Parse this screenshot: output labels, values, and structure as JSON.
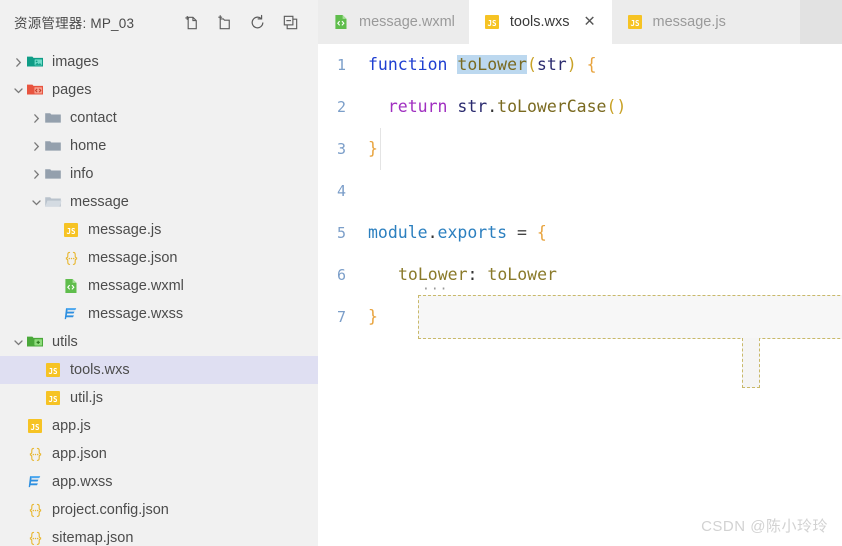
{
  "sidebar": {
    "title": "资源管理器: MP_03",
    "actions": [
      {
        "name": "new-file-icon",
        "label": "新建文件"
      },
      {
        "name": "new-folder-icon",
        "label": "新建文件夹"
      },
      {
        "name": "refresh-icon",
        "label": "刷新"
      },
      {
        "name": "collapse-all-icon",
        "label": "折叠全部"
      }
    ],
    "tree": [
      {
        "label": "images",
        "type": "folder",
        "icon": "folder-images-icon",
        "state": "collapsed",
        "depth": 0,
        "selected": false
      },
      {
        "label": "pages",
        "type": "folder",
        "icon": "folder-pages-icon",
        "state": "expanded",
        "depth": 0,
        "selected": false
      },
      {
        "label": "contact",
        "type": "folder",
        "icon": "folder-plain-icon",
        "state": "collapsed",
        "depth": 1,
        "selected": false
      },
      {
        "label": "home",
        "type": "folder",
        "icon": "folder-plain-icon",
        "state": "collapsed",
        "depth": 1,
        "selected": false
      },
      {
        "label": "info",
        "type": "folder",
        "icon": "folder-plain-icon",
        "state": "collapsed",
        "depth": 1,
        "selected": false
      },
      {
        "label": "message",
        "type": "folder",
        "icon": "folder-open-icon",
        "state": "expanded",
        "depth": 1,
        "selected": false
      },
      {
        "label": "message.js",
        "type": "file",
        "icon": "js-file-icon",
        "state": "none",
        "depth": 2,
        "selected": false
      },
      {
        "label": "message.json",
        "type": "file",
        "icon": "json-file-icon",
        "state": "none",
        "depth": 2,
        "selected": false
      },
      {
        "label": "message.wxml",
        "type": "file",
        "icon": "wxml-file-icon",
        "state": "none",
        "depth": 2,
        "selected": false
      },
      {
        "label": "message.wxss",
        "type": "file",
        "icon": "wxss-file-icon",
        "state": "none",
        "depth": 2,
        "selected": false
      },
      {
        "label": "utils",
        "type": "folder",
        "icon": "folder-utils-icon",
        "state": "expanded",
        "depth": 0,
        "selected": false
      },
      {
        "label": "tools.wxs",
        "type": "file",
        "icon": "js-file-icon",
        "state": "none",
        "depth": 1,
        "selected": true
      },
      {
        "label": "util.js",
        "type": "file",
        "icon": "js-file-icon",
        "state": "none",
        "depth": 1,
        "selected": false
      },
      {
        "label": "app.js",
        "type": "file",
        "icon": "js-file-icon",
        "state": "none",
        "depth": 0,
        "selected": false
      },
      {
        "label": "app.json",
        "type": "file",
        "icon": "json-file-icon",
        "state": "none",
        "depth": 0,
        "selected": false
      },
      {
        "label": "app.wxss",
        "type": "file",
        "icon": "wxss-file-icon",
        "state": "none",
        "depth": 0,
        "selected": false
      },
      {
        "label": "project.config.json",
        "type": "file",
        "icon": "json-file-icon",
        "state": "none",
        "depth": 0,
        "selected": false
      },
      {
        "label": "sitemap.json",
        "type": "file",
        "icon": "json-file-icon",
        "state": "none",
        "depth": 0,
        "selected": false
      }
    ]
  },
  "tabs": [
    {
      "label": "message.wxml",
      "icon": "wxml-file-icon",
      "active": false,
      "closable": false
    },
    {
      "label": "tools.wxs",
      "icon": "js-file-icon",
      "active": true,
      "closable": true,
      "close_label": "✕"
    },
    {
      "label": "message.js",
      "icon": "js-file-icon",
      "active": false,
      "closable": false
    }
  ],
  "editor": {
    "language": "wxs",
    "lines": [
      {
        "num": "1",
        "text": "function toLower(str) {"
      },
      {
        "num": "2",
        "text": "  return str.toLowerCase()"
      },
      {
        "num": "3",
        "text": "}"
      },
      {
        "num": "4",
        "text": ""
      },
      {
        "num": "5",
        "text": "module.exports = {"
      },
      {
        "num": "6",
        "text": "  toLower: toLower"
      },
      {
        "num": "7",
        "text": "}"
      }
    ],
    "tokens": {
      "l1_function": "function",
      "l1_name": "toLower",
      "l1_open_paren": "(",
      "l1_param": "str",
      "l1_close_paren": ")",
      "l1_space": " ",
      "l1_brace": "{",
      "l2_indent": "  ",
      "l2_return": "return",
      "l2_sp": " ",
      "l2_obj": "str",
      "l2_dot": ".",
      "l2_method": "toLowerCase",
      "l2_parens": "()",
      "l3_brace": "}",
      "l5_module": "module",
      "l5_dot": ".",
      "l5_exports": "exports",
      "l5_eq": " = ",
      "l5_brace": "{",
      "l6_indent": "  ",
      "l6_key": "toLower",
      "l6_colon": ": ",
      "l6_value": "toLower",
      "l7_brace": "}"
    },
    "selection": {
      "line1_token": "toLower",
      "line6_token": "toLower"
    },
    "snippet_ellipsis": "···"
  },
  "watermark": "CSDN @陈小玲玲",
  "colors": {
    "sidebar_bg": "#f1f1f1",
    "selected_row_bg": "#dfdff2",
    "tabbar_bg": "#ececec",
    "active_tab_bg": "#ffffff",
    "editor_bg": "#ffffff",
    "linenumber": "#7b9ec9",
    "keyword": "#1f3fd1",
    "keyword_alt": "#a02fc0",
    "function_name": "#7a6a20",
    "property": "#2b7fbf",
    "paren": "#c9a227",
    "brace": "#e8a33d",
    "selection_blue": "#bcd8ef",
    "selection_grey": "#cfcfcf",
    "caret_block": "#8d8d8d",
    "snippet_border": "#c9b96a",
    "watermark": "#d2d2d2"
  }
}
